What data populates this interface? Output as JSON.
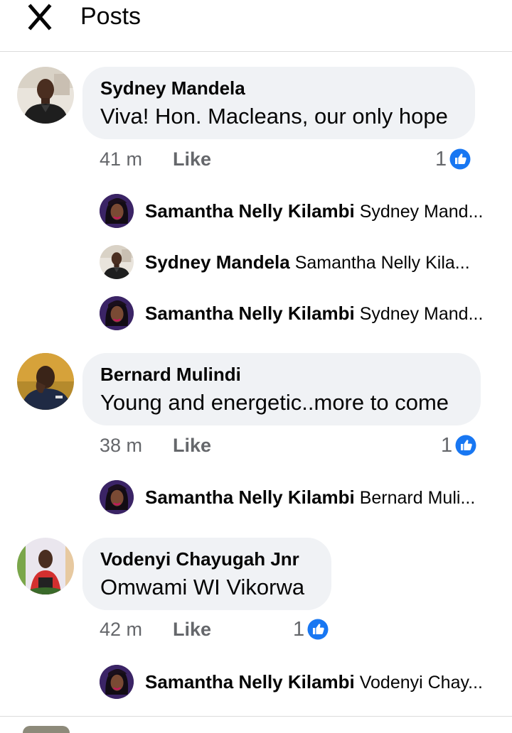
{
  "header": {
    "close_icon": "close-icon",
    "title": "Posts"
  },
  "colors": {
    "bubble": "#f0f2f5",
    "meta_text": "#65676b",
    "like_blue": "#1877f2",
    "divider": "#dcdcdc"
  },
  "comments": [
    {
      "author": "Sydney Mandela",
      "text": "Viva! Hon. Macleans, our only hope",
      "time": "41 m",
      "like_label": "Like",
      "reactions": "1",
      "reaction_icon": "thumbs-up-icon",
      "replies": [
        {
          "name": "Samantha Nelly Kilambi",
          "preview": "Sydney Mand..."
        },
        {
          "name": "Sydney Mandela",
          "preview": "Samantha Nelly Kila..."
        },
        {
          "name": "Samantha Nelly Kilambi",
          "preview": "Sydney Mand..."
        }
      ]
    },
    {
      "author": "Bernard Mulindi",
      "text": "Young and energetic..more to come",
      "time": "38 m",
      "like_label": "Like",
      "reactions": "1",
      "reaction_icon": "thumbs-up-icon",
      "replies": [
        {
          "name": "Samantha Nelly Kilambi",
          "preview": "Bernard Muli..."
        }
      ]
    },
    {
      "author": "Vodenyi Chayugah Jnr",
      "text": "Omwami WI Vikorwa",
      "time": "42 m",
      "like_label": "Like",
      "reactions": "1",
      "reaction_icon": "thumbs-up-icon",
      "replies": [
        {
          "name": "Samantha Nelly Kilambi",
          "preview": "Vodenyi Chay..."
        }
      ]
    }
  ]
}
